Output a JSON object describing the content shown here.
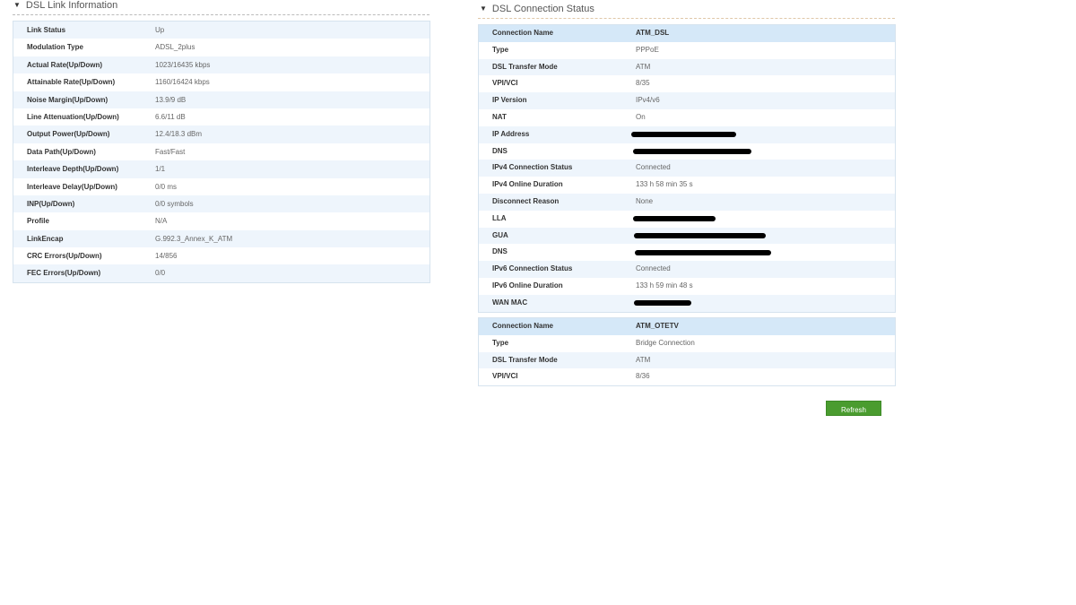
{
  "link_info": {
    "title": "DSL Link Information",
    "rows": [
      {
        "label": "Link Status",
        "value": "Up"
      },
      {
        "label": "Modulation Type",
        "value": "ADSL_2plus"
      },
      {
        "label": "Actual Rate(Up/Down)",
        "value": "1023/16435 kbps"
      },
      {
        "label": "Attainable Rate(Up/Down)",
        "value": "1160/16424 kbps"
      },
      {
        "label": "Noise Margin(Up/Down)",
        "value": "13.9/9 dB"
      },
      {
        "label": "Line Attenuation(Up/Down)",
        "value": "6.6/11 dB"
      },
      {
        "label": "Output Power(Up/Down)",
        "value": "12.4/18.3 dBm"
      },
      {
        "label": "Data Path(Up/Down)",
        "value": "Fast/Fast"
      },
      {
        "label": "Interleave Depth(Up/Down)",
        "value": "1/1"
      },
      {
        "label": "Interleave Delay(Up/Down)",
        "value": "0/0 ms"
      },
      {
        "label": "INP(Up/Down)",
        "value": "0/0 symbols"
      },
      {
        "label": "Profile",
        "value": "N/A"
      },
      {
        "label": "LinkEncap",
        "value": "G.992.3_Annex_K_ATM"
      },
      {
        "label": "CRC Errors(Up/Down)",
        "value": "14/856"
      },
      {
        "label": "FEC Errors(Up/Down)",
        "value": "0/0"
      }
    ]
  },
  "connection_status": {
    "title": "DSL Connection Status",
    "connections": [
      {
        "rows": [
          {
            "label": "Connection Name",
            "value": "ATM_DSL",
            "head": true
          },
          {
            "label": "Type",
            "value": "PPPoE"
          },
          {
            "label": "DSL Transfer Mode",
            "value": "ATM"
          },
          {
            "label": "VPI/VCI",
            "value": "8/35"
          },
          {
            "label": "IP Version",
            "value": "IPv4/v6"
          },
          {
            "label": "NAT",
            "value": "On"
          },
          {
            "label": "IP Address",
            "redacted": true
          },
          {
            "label": "DNS",
            "redacted": true
          },
          {
            "label": "IPv4 Connection Status",
            "value": "Connected"
          },
          {
            "label": "IPv4 Online Duration",
            "value": "133 h 58 min 35 s"
          },
          {
            "label": "Disconnect Reason",
            "value": "None"
          },
          {
            "label": "LLA",
            "redacted": true
          },
          {
            "label": "GUA",
            "redacted": true
          },
          {
            "label": "DNS",
            "redacted": true
          },
          {
            "label": "IPv6 Connection Status",
            "value": "Connected"
          },
          {
            "label": "IPv6 Online Duration",
            "value": "133 h 59 min 48 s"
          },
          {
            "label": "WAN MAC",
            "redacted": true
          }
        ]
      },
      {
        "rows": [
          {
            "label": "Connection Name",
            "value": "ATM_OTETV",
            "head": true
          },
          {
            "label": "Type",
            "value": "Bridge Connection"
          },
          {
            "label": "DSL Transfer Mode",
            "value": "ATM"
          },
          {
            "label": "VPI/VCI",
            "value": "8/36"
          }
        ]
      }
    ]
  },
  "refresh_label": "Refresh"
}
